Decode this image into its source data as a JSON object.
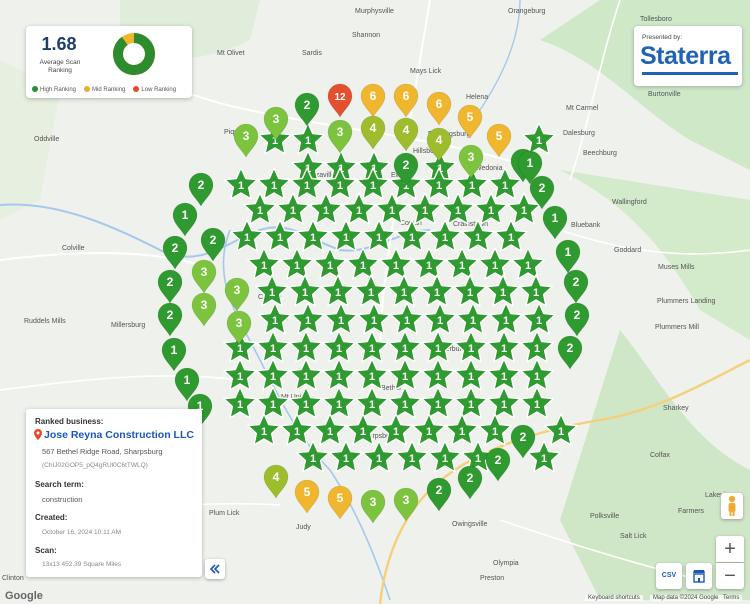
{
  "summary": {
    "average_rank": "1.68",
    "average_label": "Average Scan Ranking",
    "percent_label": "90%",
    "percent_value": 90,
    "legend": [
      {
        "label": "High Ranking",
        "color": "#2e8b2e"
      },
      {
        "label": "Mid Ranking",
        "color": "#e8ac2e"
      },
      {
        "label": "Low Ranking",
        "color": "#e24a2b"
      }
    ]
  },
  "brand": {
    "presented_by": "Presented by:",
    "name": "Staterra"
  },
  "info": {
    "ranked_business_label": "Ranked business:",
    "business_name": "Jose Reyna Construction LLC",
    "address": "567 Bethel Ridge Road, Sharpsburg",
    "place_id": "(ChIJ02GOP5_pQ4gRUl0C6tTWLQ)",
    "search_term_label": "Search term:",
    "search_term": "construction",
    "created_label": "Created:",
    "created": "October 16, 2024 10:11 AM",
    "scan_label": "Scan:",
    "scan": "13x13 452.39 Square Miles"
  },
  "map_controls": {
    "zoom_in": "+",
    "zoom_out": "−",
    "csv": "CSV"
  },
  "attribution": {
    "google": "Google",
    "shortcuts": "Keyboard shortcuts",
    "map_data": "Map data ©2024 Google",
    "terms": "Terms"
  },
  "colors": {
    "high": "#2f9a2f",
    "high_dark": "#1f7a1f",
    "mid_green": "#7cc43d",
    "mid_yellow": "#9ebd2c",
    "mid": "#f0b72e",
    "low": "#e4502e"
  },
  "map_labels": [
    {
      "text": "Murphysville"
    },
    {
      "text": "Orangeburg"
    },
    {
      "text": "Tollesboro"
    },
    {
      "text": "Shannon"
    },
    {
      "text": "Mt Olivet"
    },
    {
      "text": "Sardis"
    },
    {
      "text": "Mays Lick"
    },
    {
      "text": "Helena"
    },
    {
      "text": "Mt Carmel"
    },
    {
      "text": "Burtonville"
    },
    {
      "text": "Piqua"
    },
    {
      "text": "Oddville"
    },
    {
      "text": "Dalesburg"
    },
    {
      "text": "Beechburg"
    },
    {
      "text": "Wallingford"
    },
    {
      "text": "Bluebank"
    },
    {
      "text": "Goddard"
    },
    {
      "text": "Colville"
    },
    {
      "text": "Muses Mills"
    },
    {
      "text": "Ruddels Mills"
    },
    {
      "text": "Millersburg"
    },
    {
      "text": "Plummers Landing"
    },
    {
      "text": "Plummers Mill"
    },
    {
      "text": "Sharkey"
    },
    {
      "text": "Colfax"
    },
    {
      "text": "Owingsville"
    },
    {
      "text": "Plum Lick"
    },
    {
      "text": "Judy"
    },
    {
      "text": "Farmers"
    },
    {
      "text": "Polksville"
    },
    {
      "text": "Salt Lick"
    },
    {
      "text": "Olympia"
    },
    {
      "text": "Preston"
    },
    {
      "text": "Clinton"
    },
    {
      "text": "Lakeview"
    },
    {
      "text": "Flemingsburg"
    },
    {
      "text": "Hillsboro"
    },
    {
      "text": "Cowan"
    },
    {
      "text": "Carlisle"
    },
    {
      "text": "Sherburne"
    },
    {
      "text": "Bethel"
    },
    {
      "text": "Sharpsburg"
    },
    {
      "text": "Mt Union"
    },
    {
      "text": "Ewing"
    },
    {
      "text": "Elizaville"
    },
    {
      "text": "Wedonia"
    },
    {
      "text": "Crainstown"
    }
  ],
  "grid": {
    "markers": [
      {
        "value": 12
      },
      {
        "value": 6
      },
      {
        "value": 6
      },
      {
        "value": 6
      },
      {
        "value": 5
      },
      {
        "value": 2
      },
      {
        "value": 3
      },
      {
        "value": 3
      },
      {
        "value": 3
      },
      {
        "value": 4
      },
      {
        "value": 4
      },
      {
        "value": 4
      },
      {
        "value": 5
      },
      {
        "value": 1
      },
      {
        "value": 2
      },
      {
        "value": 3
      },
      {
        "value": 2
      },
      {
        "value": 1
      },
      {
        "value": 2
      },
      {
        "value": 2
      },
      {
        "value": 3
      },
      {
        "value": 3
      },
      {
        "value": 3
      },
      {
        "value": 2
      },
      {
        "value": 3
      },
      {
        "value": 2
      },
      {
        "value": 2
      },
      {
        "value": 2
      },
      {
        "value": 2
      },
      {
        "value": 2
      },
      {
        "value": 2
      },
      {
        "value": 4
      },
      {
        "value": 5
      },
      {
        "value": 5
      },
      {
        "value": 3
      },
      {
        "value": 3
      },
      {
        "value": 2
      },
      {
        "value": 2
      },
      {
        "value": 2
      },
      {
        "value": 1
      },
      {
        "value": 1
      },
      {
        "value": 1
      },
      {
        "value": 1
      },
      {
        "value": 1
      },
      {
        "value": 1
      }
    ],
    "star_value": 1
  }
}
